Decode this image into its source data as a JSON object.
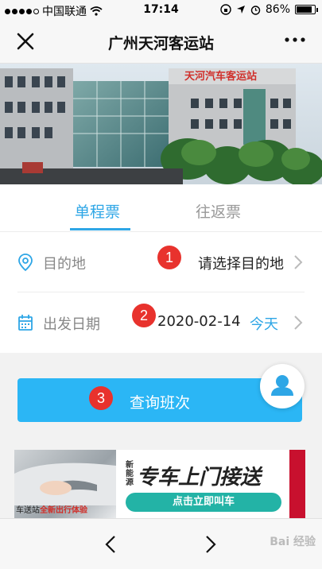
{
  "status_bar": {
    "carrier": "中国联通",
    "time": "17:14",
    "battery": "86%",
    "battery_level": 0.86
  },
  "nav": {
    "title": "广州天河客运站",
    "close_icon": "close-icon",
    "more_icon": "more-icon"
  },
  "banner": {
    "sign_text": "天河汽车客运站"
  },
  "tabs": {
    "one_way": "单程票",
    "round_trip": "往返票",
    "active": "one_way"
  },
  "form": {
    "destination": {
      "label": "目的地",
      "value": "请选择目的地",
      "badge": "1"
    },
    "departure_date": {
      "label": "出发日期",
      "value": "2020-02-14",
      "today_label": "今天",
      "badge": "2"
    }
  },
  "search": {
    "label": "查询班次",
    "badge": "3"
  },
  "ad": {
    "tag": "新能源",
    "title": "专车上门接送",
    "cta": "点击立即叫车",
    "caption_bold": "全新出行体验",
    "caption_prefix": "车送站"
  },
  "bottom": {
    "watermark": "Bai 经验"
  },
  "colors": {
    "accent": "#2ea6e6",
    "button": "#2bb6f5",
    "badge": "#e8322d"
  }
}
